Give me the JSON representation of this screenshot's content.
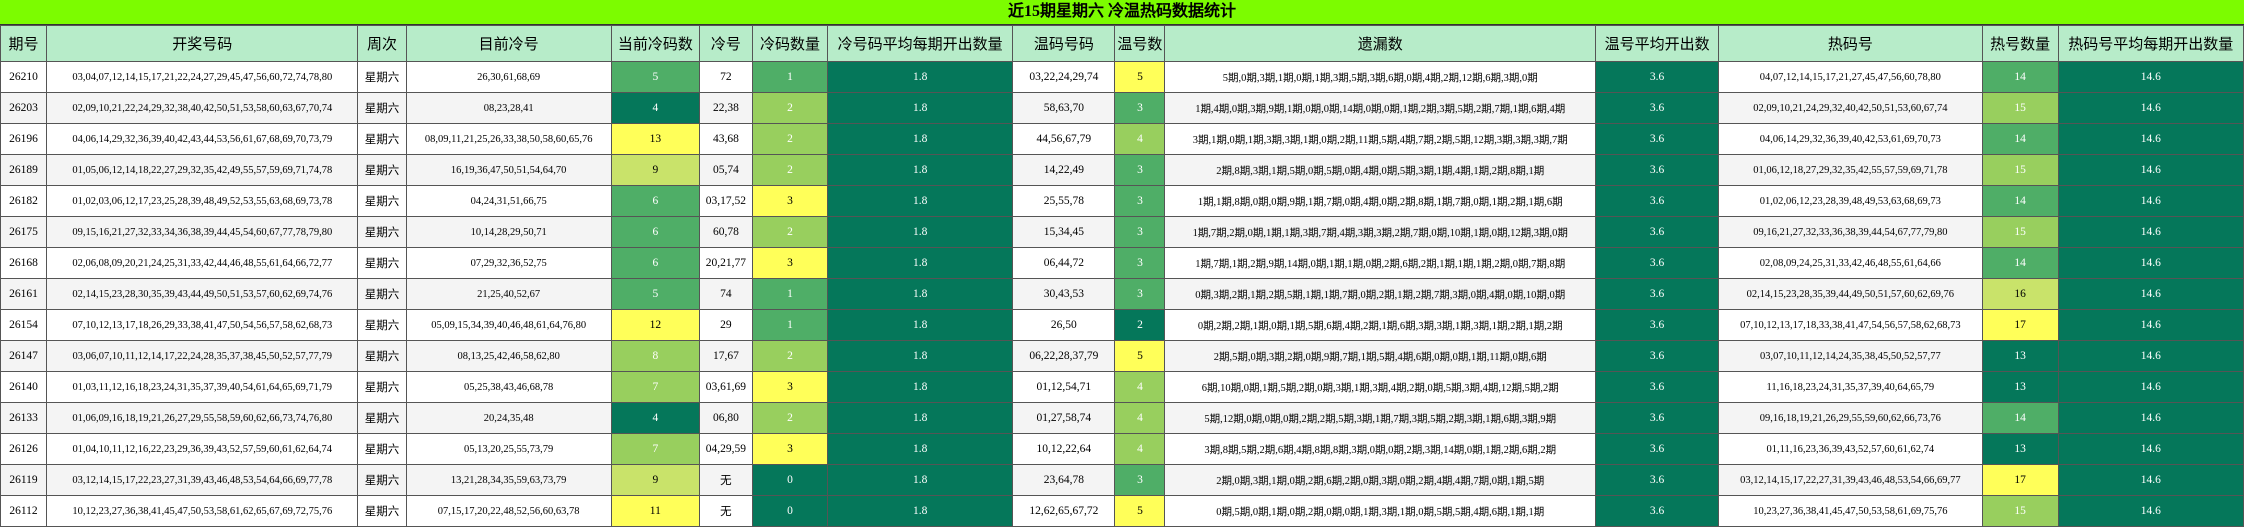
{
  "title": "近15期星期六 冷温热码数据统计",
  "headers": [
    "期号",
    "开奖号码",
    "周次",
    "目前冷号",
    "当前冷码数",
    "冷号",
    "冷码数量",
    "冷号码平均每期开出数量",
    "温码号码",
    "温号数",
    "遗漏数",
    "温号平均开出数",
    "热码号",
    "热号数量",
    "热码号平均每期开出数量"
  ],
  "rows": [
    [
      "26210",
      "03,04,07,12,14,15,17,21,22,24,27,29,45,47,56,60,72,74,78,80",
      "星期六",
      "26,30,61,68,69",
      "5",
      "72",
      "1",
      "1.8",
      "03,22,24,29,74",
      "5",
      "5期,0期,3期,1期,0期,1期,3期,5期,3期,6期,0期,4期,2期,12期,6期,3期,0期",
      "3.6",
      "04,07,12,14,15,17,21,27,45,47,56,60,78,80",
      "14",
      "14.6"
    ],
    [
      "26203",
      "02,09,10,21,22,24,29,32,38,40,42,50,51,53,58,60,63,67,70,74",
      "星期六",
      "08,23,28,41",
      "4",
      "22,38",
      "2",
      "1.8",
      "58,63,70",
      "3",
      "1期,4期,0期,3期,9期,1期,0期,0期,14期,0期,0期,1期,2期,3期,5期,2期,7期,1期,6期,4期",
      "3.6",
      "02,09,10,21,24,29,32,40,42,50,51,53,60,67,74",
      "15",
      "14.6"
    ],
    [
      "26196",
      "04,06,14,29,32,36,39,40,42,43,44,53,56,61,67,68,69,70,73,79",
      "星期六",
      "08,09,11,21,25,26,33,38,50,58,60,65,76",
      "13",
      "43,68",
      "2",
      "1.8",
      "44,56,67,79",
      "4",
      "3期,1期,0期,1期,3期,3期,1期,0期,2期,11期,5期,4期,7期,2期,5期,12期,3期,3期,3期,7期",
      "3.6",
      "04,06,14,29,32,36,39,40,42,53,61,69,70,73",
      "14",
      "14.6"
    ],
    [
      "26189",
      "01,05,06,12,14,18,22,27,29,32,35,42,49,55,57,59,69,71,74,78",
      "星期六",
      "16,19,36,47,50,51,54,64,70",
      "9",
      "05,74",
      "2",
      "1.8",
      "14,22,49",
      "3",
      "2期,8期,3期,1期,5期,0期,5期,0期,4期,0期,5期,3期,1期,4期,1期,2期,8期,1期",
      "3.6",
      "01,06,12,18,27,29,32,35,42,55,57,59,69,71,78",
      "15",
      "14.6"
    ],
    [
      "26182",
      "01,02,03,06,12,17,23,25,28,39,48,49,52,53,55,63,68,69,73,78",
      "星期六",
      "04,24,31,51,66,75",
      "6",
      "03,17,52",
      "3",
      "1.8",
      "25,55,78",
      "3",
      "1期,1期,8期,0期,0期,9期,1期,7期,0期,4期,0期,2期,8期,1期,7期,0期,1期,2期,1期,6期",
      "3.6",
      "01,02,06,12,23,28,39,48,49,53,63,68,69,73",
      "14",
      "14.6"
    ],
    [
      "26175",
      "09,15,16,21,27,32,33,34,36,38,39,44,45,54,60,67,77,78,79,80",
      "星期六",
      "10,14,28,29,50,71",
      "6",
      "60,78",
      "2",
      "1.8",
      "15,34,45",
      "3",
      "1期,7期,2期,0期,1期,1期,3期,7期,4期,3期,3期,2期,7期,0期,10期,1期,0期,12期,3期,0期",
      "3.6",
      "09,16,21,27,32,33,36,38,39,44,54,67,77,79,80",
      "15",
      "14.6"
    ],
    [
      "26168",
      "02,06,08,09,20,21,24,25,31,33,42,44,46,48,55,61,64,66,72,77",
      "星期六",
      "07,29,32,36,52,75",
      "6",
      "20,21,77",
      "3",
      "1.8",
      "06,44,72",
      "3",
      "1期,7期,1期,2期,9期,14期,0期,1期,1期,0期,2期,6期,2期,1期,1期,1期,2期,0期,7期,8期",
      "3.6",
      "02,08,09,24,25,31,33,42,46,48,55,61,64,66",
      "14",
      "14.6"
    ],
    [
      "26161",
      "02,14,15,23,28,30,35,39,43,44,49,50,51,53,57,60,62,69,74,76",
      "星期六",
      "21,25,40,52,67",
      "5",
      "74",
      "1",
      "1.8",
      "30,43,53",
      "3",
      "0期,3期,2期,1期,2期,5期,1期,1期,7期,0期,2期,1期,2期,7期,3期,0期,4期,0期,10期,0期",
      "3.6",
      "02,14,15,23,28,35,39,44,49,50,51,57,60,62,69,76",
      "16",
      "14.6"
    ],
    [
      "26154",
      "07,10,12,13,17,18,26,29,33,38,41,47,50,54,56,57,58,62,68,73",
      "星期六",
      "05,09,15,34,39,40,46,48,61,64,76,80",
      "12",
      "29",
      "1",
      "1.8",
      "26,50",
      "2",
      "0期,2期,2期,1期,0期,1期,5期,6期,4期,2期,1期,6期,3期,3期,1期,3期,1期,2期,1期,2期",
      "3.6",
      "07,10,12,13,17,18,33,38,41,47,54,56,57,58,62,68,73",
      "17",
      "14.6"
    ],
    [
      "26147",
      "03,06,07,10,11,12,14,17,22,24,28,35,37,38,45,50,52,57,77,79",
      "星期六",
      "08,13,25,42,46,58,62,80",
      "8",
      "17,67",
      "2",
      "1.8",
      "06,22,28,37,79",
      "5",
      "2期,5期,0期,3期,2期,0期,9期,7期,1期,5期,4期,6期,0期,0期,1期,11期,0期,6期",
      "3.6",
      "03,07,10,11,12,14,24,35,38,45,50,52,57,77",
      "13",
      "14.6"
    ],
    [
      "26140",
      "01,03,11,12,16,18,23,24,31,35,37,39,40,54,61,64,65,69,71,79",
      "星期六",
      "05,25,38,43,46,68,78",
      "7",
      "03,61,69",
      "3",
      "1.8",
      "01,12,54,71",
      "4",
      "6期,10期,0期,1期,5期,2期,0期,3期,1期,3期,4期,2期,0期,5期,3期,4期,12期,5期,2期",
      "3.6",
      "11,16,18,23,24,31,35,37,39,40,64,65,79",
      "13",
      "14.6"
    ],
    [
      "26133",
      "01,06,09,16,18,19,21,26,27,29,55,58,59,60,62,66,73,74,76,80",
      "星期六",
      "20,24,35,48",
      "4",
      "06,80",
      "2",
      "1.8",
      "01,27,58,74",
      "4",
      "5期,12期,0期,0期,0期,2期,2期,5期,3期,1期,7期,3期,5期,2期,3期,1期,6期,3期,9期",
      "3.6",
      "09,16,18,19,21,26,29,55,59,60,62,66,73,76",
      "14",
      "14.6"
    ],
    [
      "26126",
      "01,04,10,11,12,16,22,23,29,36,39,43,52,57,59,60,61,62,64,74",
      "星期六",
      "05,13,20,25,55,73,79",
      "7",
      "04,29,59",
      "3",
      "1.8",
      "10,12,22,64",
      "4",
      "3期,8期,5期,2期,6期,4期,8期,8期,3期,0期,0期,2期,3期,14期,0期,1期,2期,6期,2期",
      "3.6",
      "01,11,16,23,36,39,43,52,57,60,61,62,74",
      "13",
      "14.6"
    ],
    [
      "26119",
      "03,12,14,15,17,22,23,27,31,39,43,46,48,53,54,64,66,69,77,78",
      "星期六",
      "13,21,28,34,35,59,63,73,79",
      "9",
      "无",
      "0",
      "1.8",
      "23,64,78",
      "3",
      "2期,0期,3期,1期,0期,2期,6期,2期,0期,3期,0期,2期,4期,4期,7期,0期,1期,5期",
      "3.6",
      "03,12,14,15,17,22,27,31,39,43,46,48,53,54,66,69,77",
      "17",
      "14.6"
    ],
    [
      "26112",
      "10,12,23,27,36,38,41,45,47,50,53,58,61,62,65,67,69,72,75,76",
      "星期六",
      "07,15,17,20,22,48,52,56,60,63,78",
      "11",
      "无",
      "0",
      "1.8",
      "12,62,65,67,72",
      "5",
      "0期,5期,0期,1期,0期,2期,0期,0期,1期,3期,1期,0期,5期,5期,4期,6期,1期,1期",
      "3.6",
      "10,23,27,36,38,41,45,47,50,53,58,61,69,75,76",
      "15",
      "14.6"
    ]
  ],
  "colors": {
    "title_bg": "#7cfc00",
    "header_bg": "#b7ecc9",
    "dark_green": "#05775a",
    "mid_green": "#4fae67",
    "light_green": "#98cf5e",
    "lime": "#c9e36a",
    "yellow": "#ffff59"
  }
}
